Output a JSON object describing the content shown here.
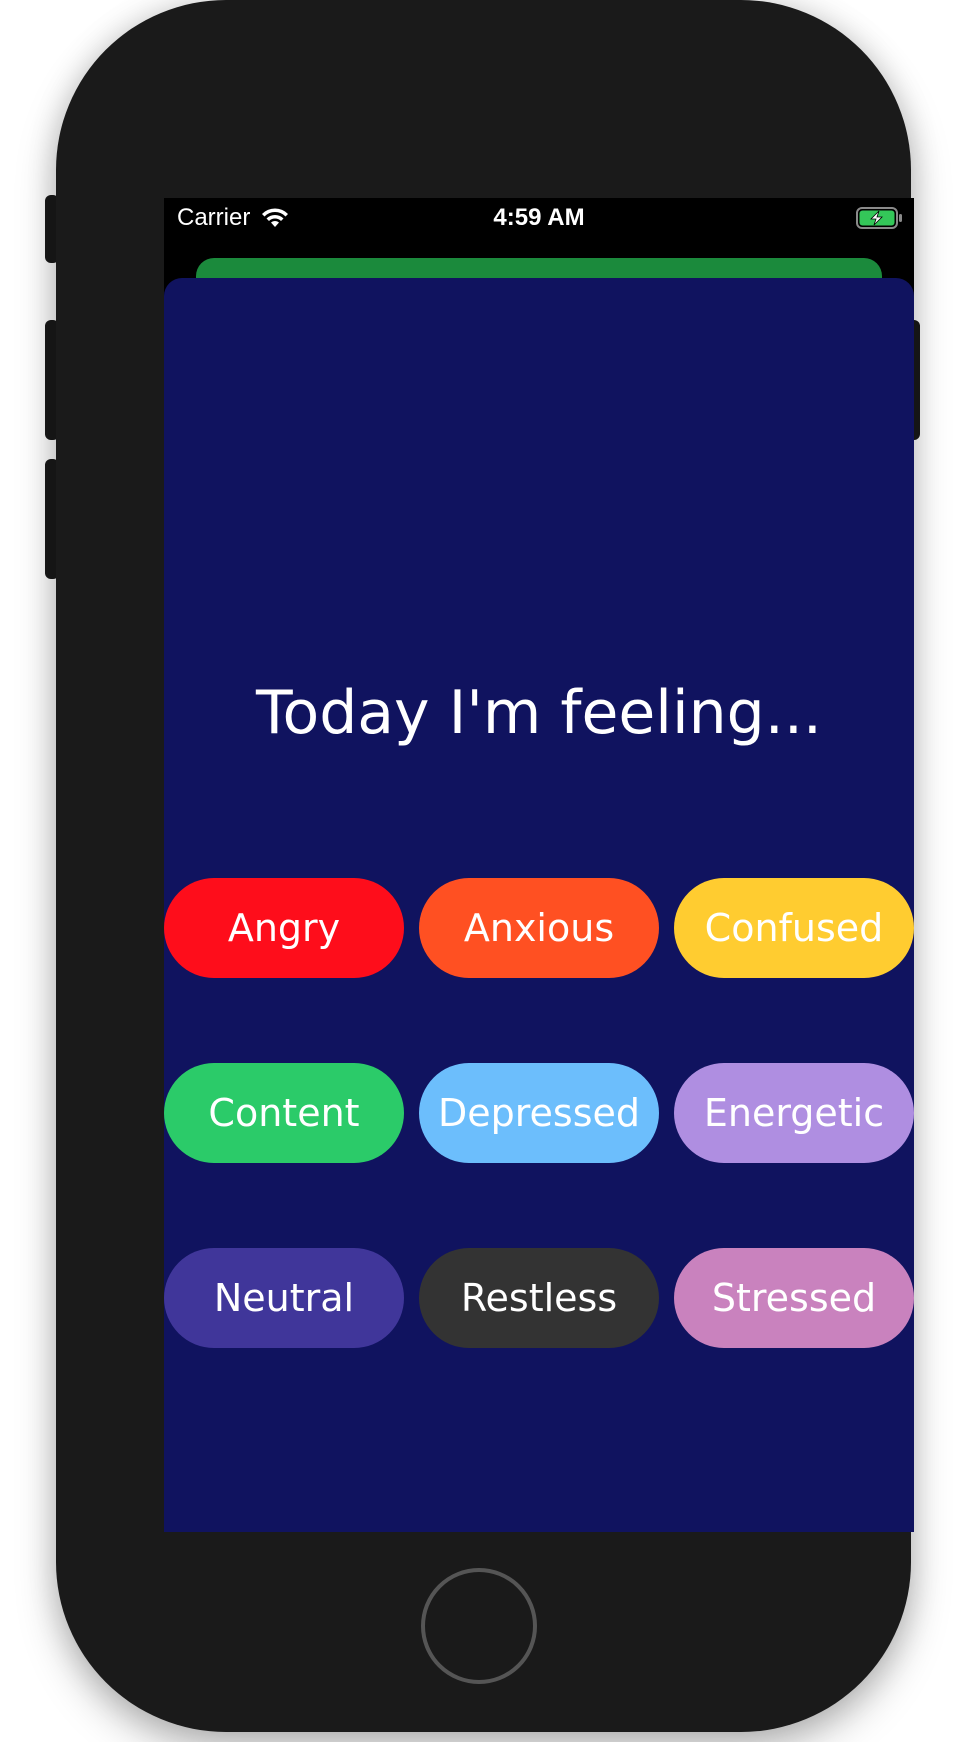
{
  "status_bar": {
    "carrier": "Carrier",
    "time": "4:59 AM",
    "wifi_icon": "wifi-icon",
    "battery_icon": "battery-charging-icon",
    "battery_color": "#34c759"
  },
  "header_card_color": "#1b8a3c",
  "sheet": {
    "background": "#10135f",
    "heading": "Today I'm feeling..."
  },
  "moods": [
    [
      {
        "label": "Angry",
        "color": "#fe0d1b"
      },
      {
        "label": "Anxious",
        "color": "#ff5022"
      },
      {
        "label": "Confused",
        "color": "#ffcc30"
      }
    ],
    [
      {
        "label": "Content",
        "color": "#2bcb69"
      },
      {
        "label": "Depressed",
        "color": "#6cbefc"
      },
      {
        "label": "Energetic",
        "color": "#af8ee1"
      }
    ],
    [
      {
        "label": "Neutral",
        "color": "#40369a"
      },
      {
        "label": "Restless",
        "color": "#333333"
      },
      {
        "label": "Stressed",
        "color": "#c982be"
      }
    ]
  ]
}
